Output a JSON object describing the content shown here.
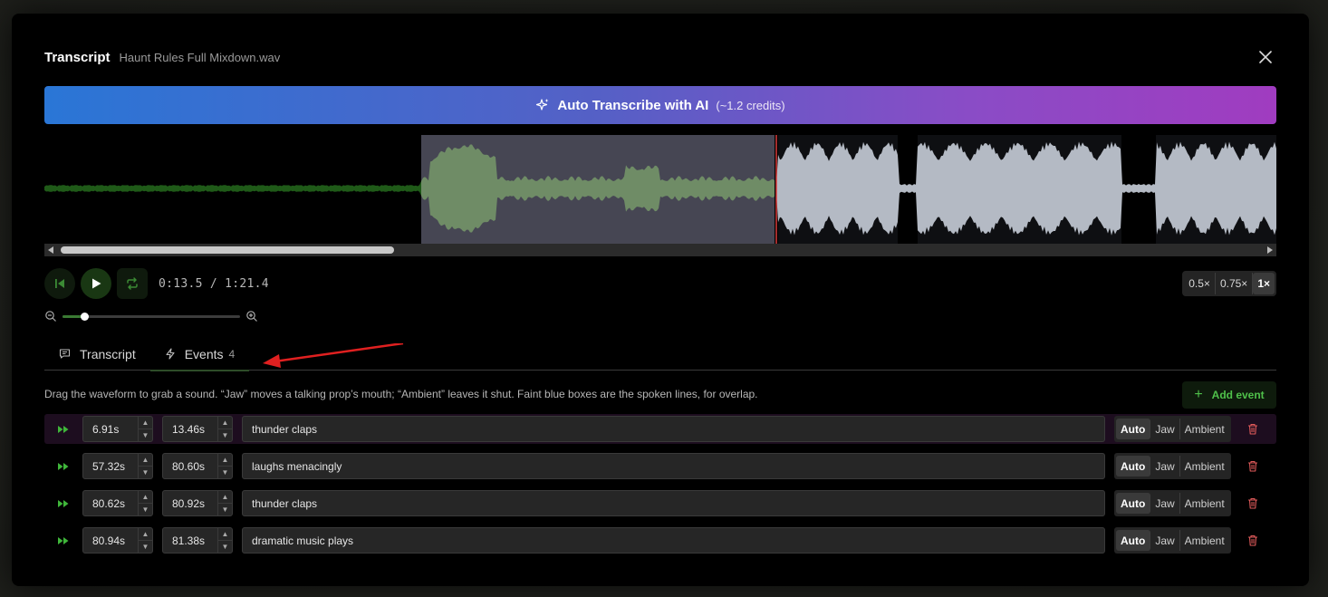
{
  "header": {
    "title": "Transcript",
    "filename": "Haunt Rules Full Mixdown.wav"
  },
  "ai_button": {
    "label": "Auto Transcribe with AI",
    "credits": "(~1.2 credits)"
  },
  "player": {
    "time": "0:13.5 / 1:21.4",
    "speeds": [
      "0.5×",
      "0.75×",
      "1×"
    ],
    "active_speed": "1×",
    "zoom_level": 0.12
  },
  "tabs": [
    {
      "label": "Transcript",
      "count": ""
    },
    {
      "label": "Events",
      "count": "4"
    }
  ],
  "events_panel": {
    "hint": "Drag the waveform to grab a sound. “Jaw” moves a talking prop’s mouth; “Ambient” leaves it shut. Faint blue boxes are the spoken lines, for overlap.",
    "add_label": "Add event",
    "modes": [
      "Auto",
      "Jaw",
      "Ambient"
    ],
    "events": [
      {
        "start": "6.91s",
        "end": "13.46s",
        "label": "thunder claps",
        "mode": "Auto"
      },
      {
        "start": "57.32s",
        "end": "80.60s",
        "label": "laughs menacingly",
        "mode": "Auto"
      },
      {
        "start": "80.62s",
        "end": "80.92s",
        "label": "thunder claps",
        "mode": "Auto"
      },
      {
        "start": "80.94s",
        "end": "81.38s",
        "label": "dramatic music plays",
        "mode": "Auto"
      }
    ]
  },
  "colors": {
    "accent_green": "#4fc04a",
    "played_wave": "#1f5a18",
    "selected_wave": "#6f8c66",
    "unplayed_wave": "#b4bac4",
    "playhead": "#d83a3a",
    "annotation_arrow": "#e02020"
  },
  "icons": {
    "close": "close-icon",
    "ai": "sparkles-icon",
    "skip_back": "skip-back-icon",
    "play": "play-icon",
    "loop": "loop-icon",
    "zoom_out": "zoom-out-icon",
    "zoom_in": "zoom-in-icon",
    "transcript_tab": "message-icon",
    "events_tab": "bolt-icon",
    "event_play": "fast-forward-icon",
    "delete": "trash-icon"
  }
}
